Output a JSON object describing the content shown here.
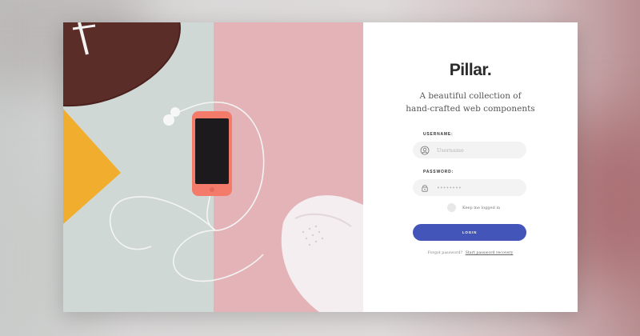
{
  "brand": {
    "logo": "Pillar.",
    "tagline_line1": "A beautiful collection of",
    "tagline_line2": "hand-crafted web components"
  },
  "form": {
    "username_label": "USERNAME:",
    "username_placeholder": "Username",
    "password_label": "PASSWORD:",
    "password_placeholder": "••••••••",
    "remember_label": "Keep me logged in",
    "login_label": "LOGIN",
    "forgot_text": "Forgot password?",
    "recovery_link": "Start password recovery"
  },
  "colors": {
    "accent": "#4355b9",
    "photo_left": "#cfd8d4",
    "photo_right": "#e3b3b7",
    "ball": "#5b2d29",
    "triangle": "#f1ae2e"
  },
  "icons": {
    "username": "user-circle-icon",
    "password": "lock-icon"
  }
}
